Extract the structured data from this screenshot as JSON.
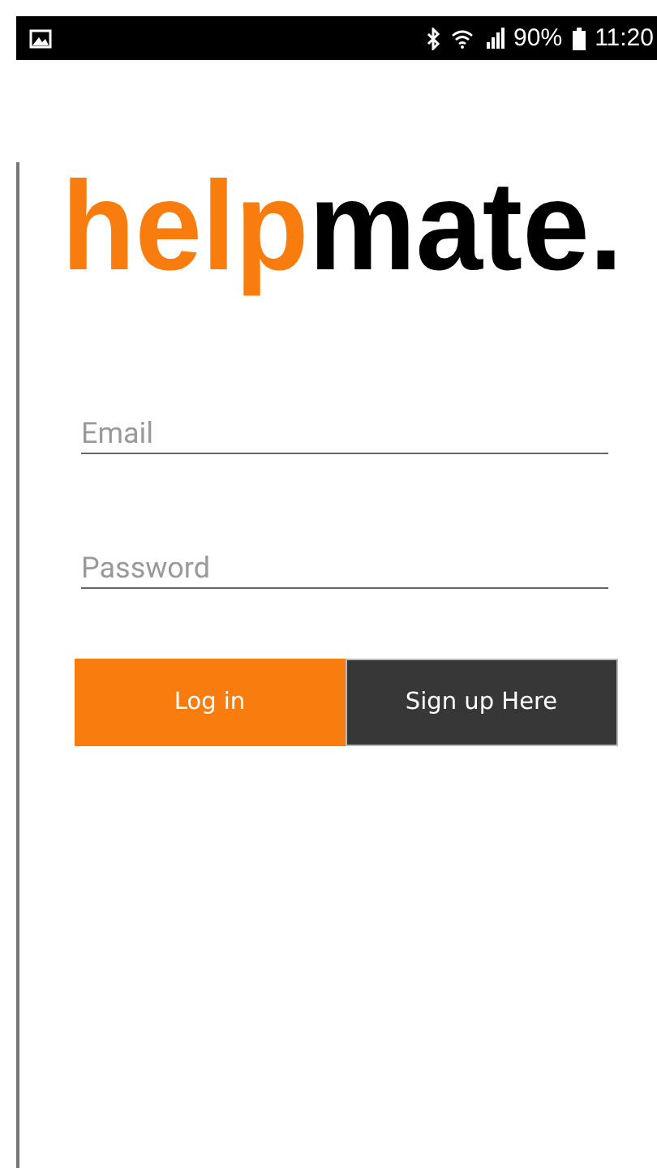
{
  "status_bar": {
    "battery": "90%",
    "time": "11:20"
  },
  "logo": [
    {
      "text": "help",
      "color": "#f97c0e"
    },
    {
      "text": "mate.",
      "color": "#000000"
    }
  ],
  "fields": [
    {
      "placeholder": "Email"
    },
    {
      "placeholder": "Password"
    }
  ],
  "buttons": [
    {
      "label": "Log in",
      "kind": "primary"
    },
    {
      "label": "Sign up Here",
      "kind": "secondary"
    }
  ]
}
